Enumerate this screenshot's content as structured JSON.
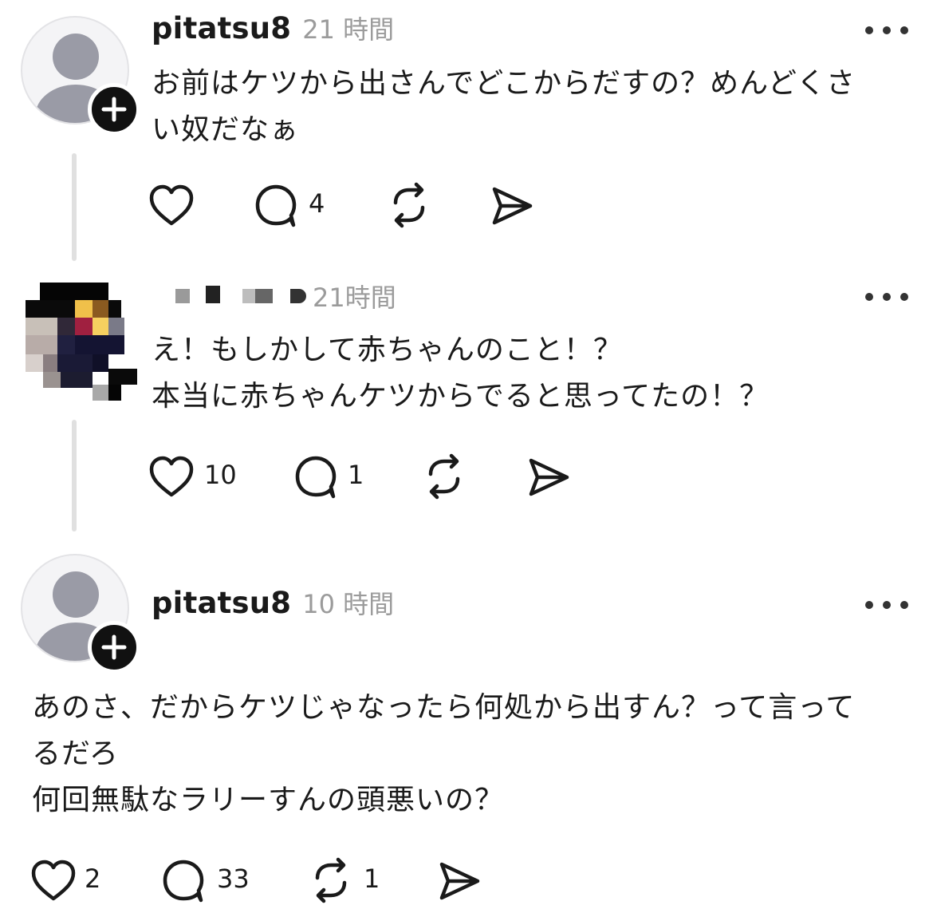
{
  "posts": [
    {
      "username": "pitatsu8",
      "time": "21 時間",
      "text": "お前はケツから出さんでどこからだすの？めんどくさ\nい奴だなぁ",
      "likes": "",
      "replies": "4",
      "reposts": ""
    },
    {
      "username": "",
      "time": "21時間",
      "text": "え！もしかして赤ちゃんのこと！？\n本当に赤ちゃんケツからでると思ってたの！？",
      "likes": "10",
      "replies": "1",
      "reposts": ""
    },
    {
      "username": "pitatsu8",
      "time": "10 時間",
      "text": "あのさ、だからケツじゃなったら何処から出すん？って言って\nるだろ\n何回無駄なラリーすんの頭悪いの？",
      "likes": "2",
      "replies": "33",
      "reposts": "1"
    }
  ],
  "icons": {
    "like": "heart-icon",
    "reply": "comment-bubble-icon",
    "repost": "repost-arrows-icon",
    "share": "send-icon",
    "more": "more-horizontal-icon",
    "follow": "plus-icon"
  }
}
